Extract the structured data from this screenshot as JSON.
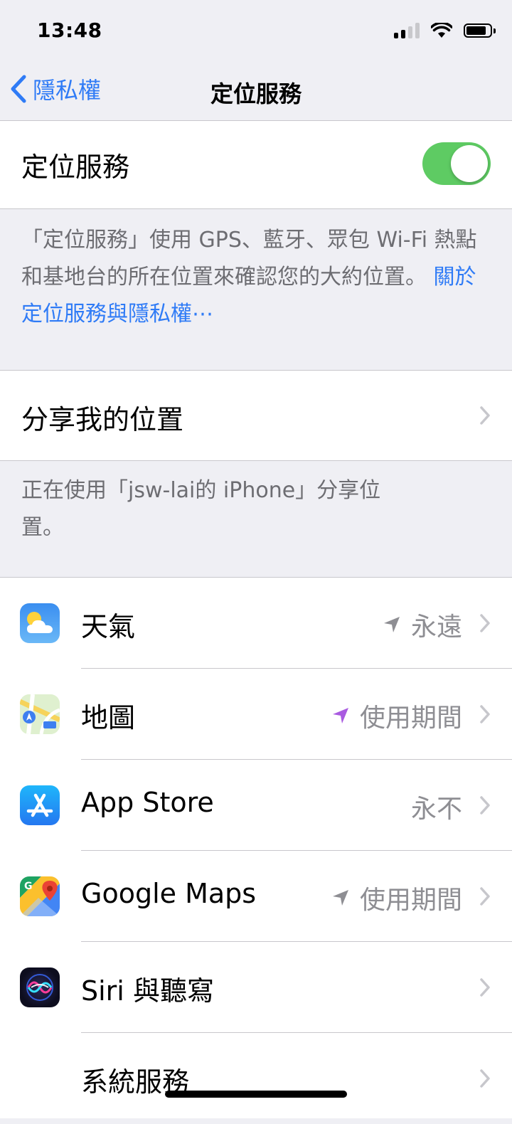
{
  "status": {
    "time": "13:48"
  },
  "nav": {
    "back_label": "隱私權",
    "title": "定位服務"
  },
  "master": {
    "label": "定位服務",
    "enabled": true
  },
  "description": {
    "text": "「定位服務」使用 GPS、藍牙、眾包 Wi-Fi 熱點和基地台的所在位置來確認您的大約位置。",
    "link": "關於定位服務與隱私權⋯"
  },
  "share": {
    "label": "分享我的位置",
    "footnote": "正在使用「jsw-lai的 iPhone」分享位置。"
  },
  "apps": [
    {
      "icon": "weather-app-icon",
      "name": "天氣",
      "value": "永遠",
      "arrow": "gray"
    },
    {
      "icon": "maps-app-icon",
      "name": "地圖",
      "value": "使用期間",
      "arrow": "purple"
    },
    {
      "icon": "app-store-icon",
      "name": "App Store",
      "value": "永不",
      "arrow": "none"
    },
    {
      "icon": "google-maps-app-icon",
      "name": "Google Maps",
      "value": "使用期間",
      "arrow": "gray"
    },
    {
      "icon": "siri-app-icon",
      "name": "Siri 與聽寫",
      "value": "",
      "arrow": "none"
    },
    {
      "icon": "none",
      "name": "系統服務",
      "value": "",
      "arrow": "none"
    }
  ],
  "colors": {
    "accent": "#2f7bf6",
    "toggle_on": "#5ecb63",
    "arrow_purple": "#a95be0",
    "secondary_text": "#8e8e93"
  }
}
